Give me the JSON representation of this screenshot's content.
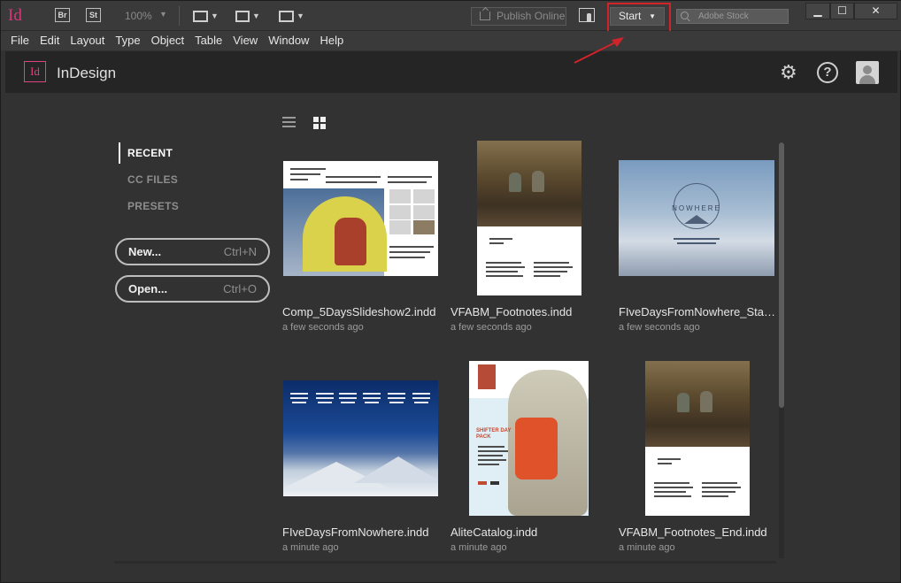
{
  "toolbar": {
    "app_logo": "Id",
    "bridge": "Br",
    "stock": "St",
    "zoom": "100%",
    "publish_label": "Publish Online",
    "start_label": "Start",
    "stock_search_placeholder": "Adobe Stock"
  },
  "menu": [
    "File",
    "Edit",
    "Layout",
    "Type",
    "Object",
    "Table",
    "View",
    "Window",
    "Help"
  ],
  "header": {
    "logo": "Id",
    "app_name": "InDesign"
  },
  "nav": {
    "recent": "RECENT",
    "cc_files": "CC FILES",
    "presets": "PRESETS"
  },
  "actions": {
    "new_label": "New...",
    "new_shortcut": "Ctrl+N",
    "open_label": "Open...",
    "open_shortcut": "Ctrl+O"
  },
  "files": [
    {
      "name": "Comp_5DaysSlideshow2.indd",
      "time": "a few seconds ago"
    },
    {
      "name": "VFABM_Footnotes.indd",
      "time": "a few seconds ago"
    },
    {
      "name": "FIveDaysFromNowhere_Stat...",
      "time": "a few seconds ago"
    },
    {
      "name": "FIveDaysFromNowhere.indd",
      "time": "a minute ago"
    },
    {
      "name": "AliteCatalog.indd",
      "time": "a minute ago"
    },
    {
      "name": "VFABM_Footnotes_End.indd",
      "time": "a minute ago"
    }
  ],
  "thumb_text": {
    "nowhere_title": "NOWHERE",
    "shifter": "SHIFTER DAY PACK"
  },
  "colors": {
    "accent_pink": "#e0437f",
    "annotation_red": "#d0232a"
  }
}
